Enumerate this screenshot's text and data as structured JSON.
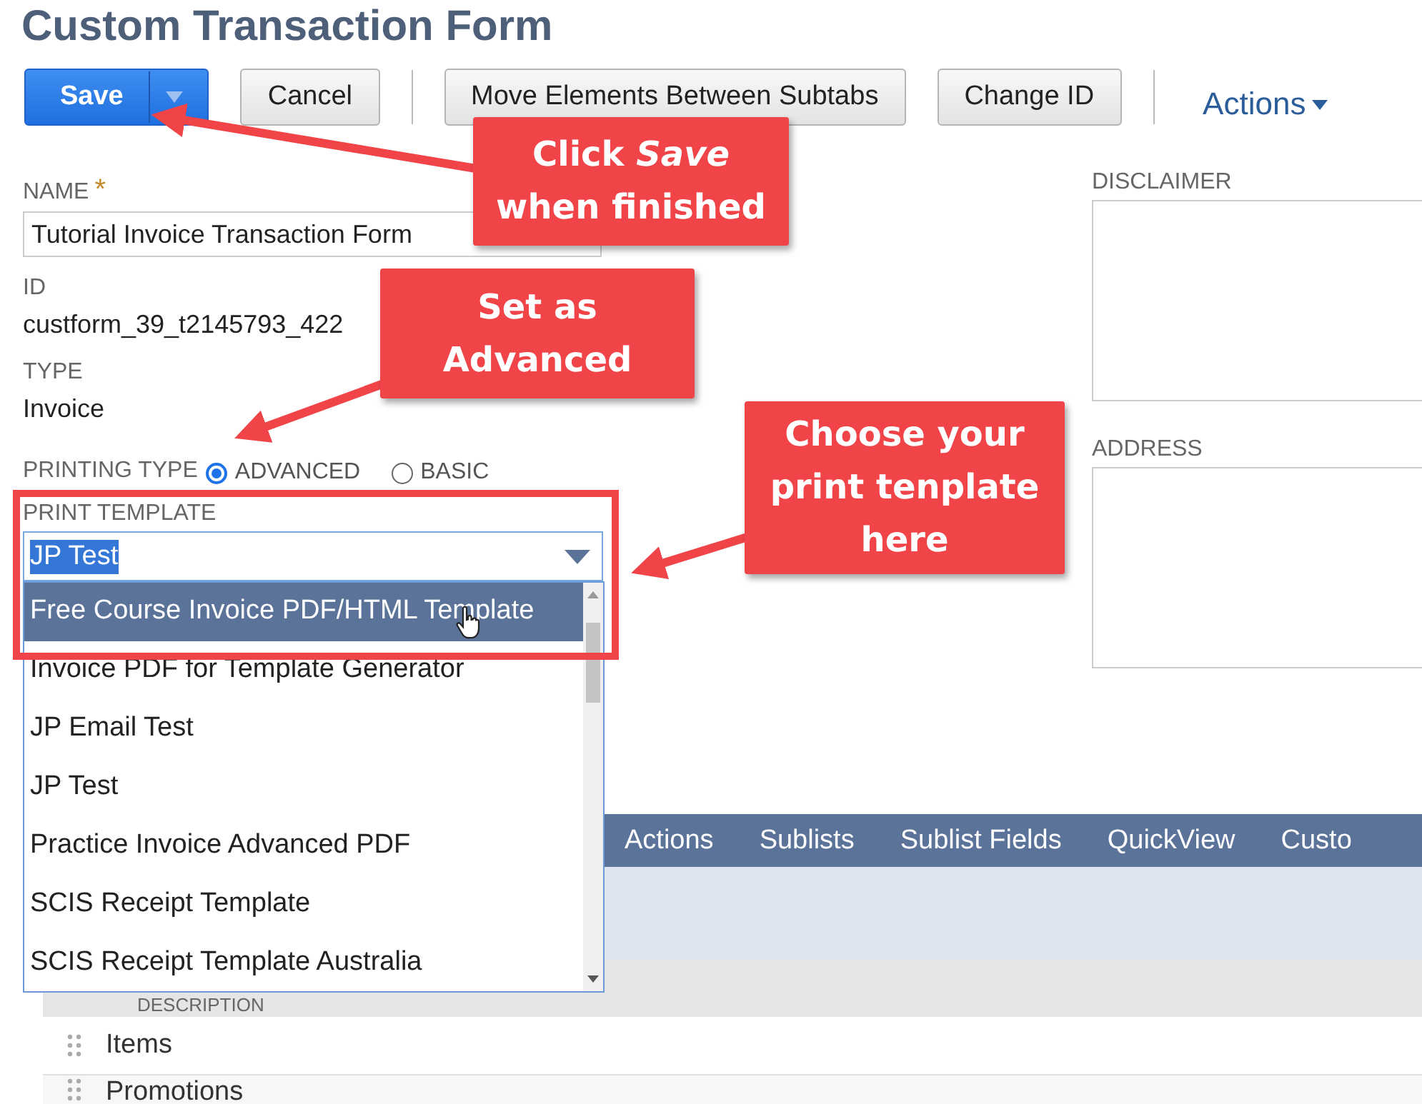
{
  "page": {
    "title": "Custom Transaction Form"
  },
  "toolbar": [
    {
      "label": "Save",
      "kind": "split"
    },
    {
      "label": "Cancel",
      "kind": "button"
    },
    {
      "label": "Move Elements Between Subtabs",
      "kind": "button"
    },
    {
      "label": "Change ID",
      "kind": "button"
    },
    {
      "label": "Actions",
      "kind": "menu"
    }
  ],
  "fields": [
    {
      "label": "NAME",
      "required_mark": "*",
      "kind": "input",
      "value": "Tutorial Invoice Transaction Form"
    },
    {
      "label": "ID",
      "kind": "text",
      "value": "custform_39_t2145793_422"
    },
    {
      "label": "TYPE",
      "kind": "text",
      "value": "Invoice"
    },
    {
      "label": "PRINTING TYPE",
      "kind": "radio",
      "options": [
        {
          "label": "ADVANCED",
          "selected": true
        },
        {
          "label": "BASIC",
          "selected": false
        }
      ]
    },
    {
      "label": "PRINT TEMPLATE",
      "kind": "select",
      "value": "JP Test"
    }
  ],
  "right_fields": [
    {
      "label": "DISCLAIMER"
    },
    {
      "label": "ADDRESS"
    }
  ],
  "dropdown": {
    "options": [
      {
        "label": "Free Course Invoice PDF/HTML Template",
        "selected": true
      },
      {
        "label": "Invoice PDF for Template Generator",
        "selected": false
      },
      {
        "label": "JP Email Test",
        "selected": false
      },
      {
        "label": "JP Test",
        "selected": false
      },
      {
        "label": "Practice Invoice Advanced PDF",
        "selected": false
      },
      {
        "label": "SCIS Receipt Template",
        "selected": false
      },
      {
        "label": "SCIS Receipt Template Australia",
        "selected": false
      }
    ]
  },
  "subtabs": [
    {
      "label": "Actions"
    },
    {
      "label": "Sublists"
    },
    {
      "label": "Sublist Fields"
    },
    {
      "label": "QuickView"
    },
    {
      "label": "Custo"
    }
  ],
  "sublist": {
    "columns": [
      "DESCRIPTION"
    ],
    "rows": [
      "Items",
      "Promotions"
    ]
  },
  "callouts": [
    {
      "lines": [
        "Click *Save*",
        "when finished"
      ]
    },
    {
      "lines": [
        "Set as",
        "Advanced"
      ]
    },
    {
      "lines": [
        "Choose your",
        "print tenplate",
        "here"
      ]
    }
  ]
}
